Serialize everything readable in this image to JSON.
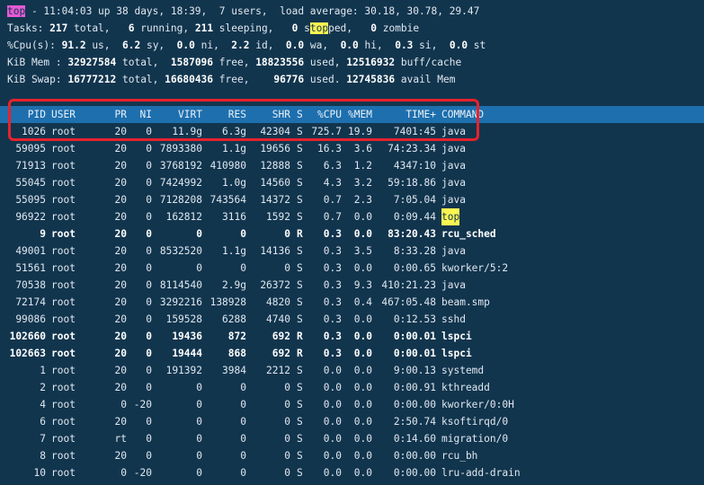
{
  "summary": {
    "line1": {
      "prog": "top",
      "rest": " - 11:04:03 up 38 days, 18:39,  7 users,  load average: 30.18, 30.78, 29.47"
    },
    "line2": {
      "a": "Tasks: ",
      "total": "217",
      "b": " total,   ",
      "running": "6",
      "c": " running, ",
      "sleeping": "211",
      "d": " sleeping,   ",
      "stopped": "0",
      "e": " s",
      "hl": "top",
      "f": "ped,   ",
      "zombie": "0",
      "g": " zombie"
    },
    "line3": {
      "a": "%Cpu(s): ",
      "us": "91.2",
      "b": " us,  ",
      "sy": "6.2",
      "c": " sy,  ",
      "ni": "0.0",
      "d": " ni,  ",
      "id": "2.2",
      "e": " id,  ",
      "wa": "0.0",
      "f": " wa,  ",
      "hi": "0.0",
      "g": " hi,  ",
      "si": "0.3",
      "h": " si,  ",
      "st": "0.0",
      "i": " st"
    },
    "line4": {
      "a": "KiB Mem : ",
      "total": "32927584",
      "b": " total,  ",
      "free": "1587096",
      "c": " free, ",
      "used": "18823556",
      "d": " used, ",
      "cache": "12516932",
      "e": " buff/cache"
    },
    "line5": {
      "a": "KiB Swap: ",
      "total": "16777212",
      "b": " total, ",
      "free": "16680436",
      "c": " free,    ",
      "used": "96776",
      "d": " used. ",
      "avail": "12745836",
      "e": " avail Mem"
    }
  },
  "columns": [
    "PID",
    "USER",
    "PR",
    "NI",
    "VIRT",
    "RES",
    "SHR",
    "S",
    "%CPU",
    "%MEM",
    "TIME+",
    "COMMAND"
  ],
  "processes": [
    {
      "pid": "1026",
      "user": "root",
      "pr": "20",
      "ni": "0",
      "virt": "11.9g",
      "res": "6.3g",
      "shr": "42304",
      "s": "S",
      "cpu": "725.7",
      "mem": "19.9",
      "time": "7401:45",
      "cmd": "java"
    },
    {
      "pid": "59095",
      "user": "root",
      "pr": "20",
      "ni": "0",
      "virt": "7893380",
      "res": "1.1g",
      "shr": "19656",
      "s": "S",
      "cpu": "16.3",
      "mem": "3.6",
      "time": "74:23.34",
      "cmd": "java"
    },
    {
      "pid": "71913",
      "user": "root",
      "pr": "20",
      "ni": "0",
      "virt": "3768192",
      "res": "410980",
      "shr": "12888",
      "s": "S",
      "cpu": "6.3",
      "mem": "1.2",
      "time": "4347:10",
      "cmd": "java"
    },
    {
      "pid": "55045",
      "user": "root",
      "pr": "20",
      "ni": "0",
      "virt": "7424992",
      "res": "1.0g",
      "shr": "14560",
      "s": "S",
      "cpu": "4.3",
      "mem": "3.2",
      "time": "59:18.86",
      "cmd": "java"
    },
    {
      "pid": "55095",
      "user": "root",
      "pr": "20",
      "ni": "0",
      "virt": "7128208",
      "res": "743564",
      "shr": "14372",
      "s": "S",
      "cpu": "0.7",
      "mem": "2.3",
      "time": "7:05.04",
      "cmd": "java"
    },
    {
      "pid": "96922",
      "user": "root",
      "pr": "20",
      "ni": "0",
      "virt": "162812",
      "res": "3116",
      "shr": "1592",
      "s": "S",
      "cpu": "0.7",
      "mem": "0.0",
      "time": "0:09.44",
      "cmd": "top"
    },
    {
      "pid": "9",
      "user": "root",
      "pr": "20",
      "ni": "0",
      "virt": "0",
      "res": "0",
      "shr": "0",
      "s": "R",
      "cpu": "0.3",
      "mem": "0.0",
      "time": "83:20.43",
      "cmd": "rcu_sched"
    },
    {
      "pid": "49001",
      "user": "root",
      "pr": "20",
      "ni": "0",
      "virt": "8532520",
      "res": "1.1g",
      "shr": "14136",
      "s": "S",
      "cpu": "0.3",
      "mem": "3.5",
      "time": "8:33.28",
      "cmd": "java"
    },
    {
      "pid": "51561",
      "user": "root",
      "pr": "20",
      "ni": "0",
      "virt": "0",
      "res": "0",
      "shr": "0",
      "s": "S",
      "cpu": "0.3",
      "mem": "0.0",
      "time": "0:00.65",
      "cmd": "kworker/5:2"
    },
    {
      "pid": "70538",
      "user": "root",
      "pr": "20",
      "ni": "0",
      "virt": "8114540",
      "res": "2.9g",
      "shr": "26372",
      "s": "S",
      "cpu": "0.3",
      "mem": "9.3",
      "time": "410:21.23",
      "cmd": "java"
    },
    {
      "pid": "72174",
      "user": "root",
      "pr": "20",
      "ni": "0",
      "virt": "3292216",
      "res": "138928",
      "shr": "4820",
      "s": "S",
      "cpu": "0.3",
      "mem": "0.4",
      "time": "467:05.48",
      "cmd": "beam.smp"
    },
    {
      "pid": "99086",
      "user": "root",
      "pr": "20",
      "ni": "0",
      "virt": "159528",
      "res": "6288",
      "shr": "4740",
      "s": "S",
      "cpu": "0.3",
      "mem": "0.0",
      "time": "0:12.53",
      "cmd": "sshd"
    },
    {
      "pid": "102660",
      "user": "root",
      "pr": "20",
      "ni": "0",
      "virt": "19436",
      "res": "872",
      "shr": "692",
      "s": "R",
      "cpu": "0.3",
      "mem": "0.0",
      "time": "0:00.01",
      "cmd": "lspci"
    },
    {
      "pid": "102663",
      "user": "root",
      "pr": "20",
      "ni": "0",
      "virt": "19444",
      "res": "868",
      "shr": "692",
      "s": "R",
      "cpu": "0.3",
      "mem": "0.0",
      "time": "0:00.01",
      "cmd": "lspci"
    },
    {
      "pid": "1",
      "user": "root",
      "pr": "20",
      "ni": "0",
      "virt": "191392",
      "res": "3984",
      "shr": "2212",
      "s": "S",
      "cpu": "0.0",
      "mem": "0.0",
      "time": "9:00.13",
      "cmd": "systemd"
    },
    {
      "pid": "2",
      "user": "root",
      "pr": "20",
      "ni": "0",
      "virt": "0",
      "res": "0",
      "shr": "0",
      "s": "S",
      "cpu": "0.0",
      "mem": "0.0",
      "time": "0:00.91",
      "cmd": "kthreadd"
    },
    {
      "pid": "4",
      "user": "root",
      "pr": "0",
      "ni": "-20",
      "virt": "0",
      "res": "0",
      "shr": "0",
      "s": "S",
      "cpu": "0.0",
      "mem": "0.0",
      "time": "0:00.00",
      "cmd": "kworker/0:0H"
    },
    {
      "pid": "6",
      "user": "root",
      "pr": "20",
      "ni": "0",
      "virt": "0",
      "res": "0",
      "shr": "0",
      "s": "S",
      "cpu": "0.0",
      "mem": "0.0",
      "time": "2:50.74",
      "cmd": "ksoftirqd/0"
    },
    {
      "pid": "7",
      "user": "root",
      "pr": "rt",
      "ni": "0",
      "virt": "0",
      "res": "0",
      "shr": "0",
      "s": "S",
      "cpu": "0.0",
      "mem": "0.0",
      "time": "0:14.60",
      "cmd": "migration/0"
    },
    {
      "pid": "8",
      "user": "root",
      "pr": "20",
      "ni": "0",
      "virt": "0",
      "res": "0",
      "shr": "0",
      "s": "S",
      "cpu": "0.0",
      "mem": "0.0",
      "time": "0:00.00",
      "cmd": "rcu_bh"
    },
    {
      "pid": "10",
      "user": "root",
      "pr": "0",
      "ni": "-20",
      "virt": "0",
      "res": "0",
      "shr": "0",
      "s": "S",
      "cpu": "0.0",
      "mem": "0.0",
      "time": "0:00.00",
      "cmd": "lru-add-drain"
    }
  ],
  "colors": {
    "background": "#12354e",
    "header_bar": "#1e6fae",
    "highlight_pink": "#e65ad7",
    "highlight_yellow": "#fbf552",
    "annotation_box": "#e8222c"
  }
}
